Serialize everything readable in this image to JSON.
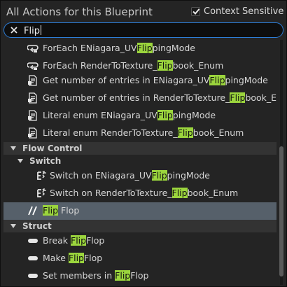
{
  "header": {
    "title": "All Actions for this Blueprint",
    "context_sensitive_label": "Context Sensitive",
    "context_sensitive_checked": true
  },
  "search": {
    "value": "Flip"
  },
  "items": [
    {
      "kind": "action",
      "icon": "foreach-loop-icon",
      "pre": "ForEach ENiagara_UV",
      "match": "Flip",
      "post": "pingMode"
    },
    {
      "kind": "action",
      "icon": "foreach-loop-icon",
      "pre": "ForEach RenderToTexture_",
      "match": "Flip",
      "post": "book_Enum"
    },
    {
      "kind": "action",
      "icon": "function-doc-icon",
      "pre": "Get number of entries in ENiagara_UV",
      "match": "Flip",
      "post": "pingMode"
    },
    {
      "kind": "action",
      "icon": "function-doc-icon",
      "pre": "Get number of entries in RenderToTexture_",
      "match": "Flip",
      "post": "book_Enum"
    },
    {
      "kind": "action",
      "icon": "function-doc-icon",
      "pre": "Literal enum ENiagara_UV",
      "match": "Flip",
      "post": "pingMode"
    },
    {
      "kind": "action",
      "icon": "function-doc-icon",
      "pre": "Literal enum RenderToTexture_",
      "match": "Flip",
      "post": "book_Enum"
    },
    {
      "kind": "category",
      "label": "Flow Control"
    },
    {
      "kind": "subcategory",
      "label": "Switch"
    },
    {
      "kind": "action",
      "icon": "switch-node-icon",
      "pre": "Switch on ENiagara_UV",
      "match": "Flip",
      "post": "pingMode"
    },
    {
      "kind": "action",
      "icon": "switch-node-icon",
      "pre": "Switch on RenderToTexture_",
      "match": "Flip",
      "post": "book_Enum"
    },
    {
      "kind": "action",
      "icon": "flipflop-icon",
      "pre": "",
      "match": "Flip",
      "post": " Flop",
      "selected": true
    },
    {
      "kind": "category",
      "label": "Struct"
    },
    {
      "kind": "action",
      "icon": "struct-pill-icon",
      "pre": "Break ",
      "match": "Flip",
      "post": "Flop"
    },
    {
      "kind": "action",
      "icon": "struct-pill-icon",
      "pre": "Make ",
      "match": "Flip",
      "post": "Flop"
    },
    {
      "kind": "action",
      "icon": "struct-pill-icon",
      "pre": "Set members in ",
      "match": "Flip",
      "post": "Flop"
    }
  ],
  "colors": {
    "highlight": "#9bd53d",
    "selected_row": "#56606a",
    "category_bg": "#333333",
    "search_border": "#2c7ed9"
  }
}
